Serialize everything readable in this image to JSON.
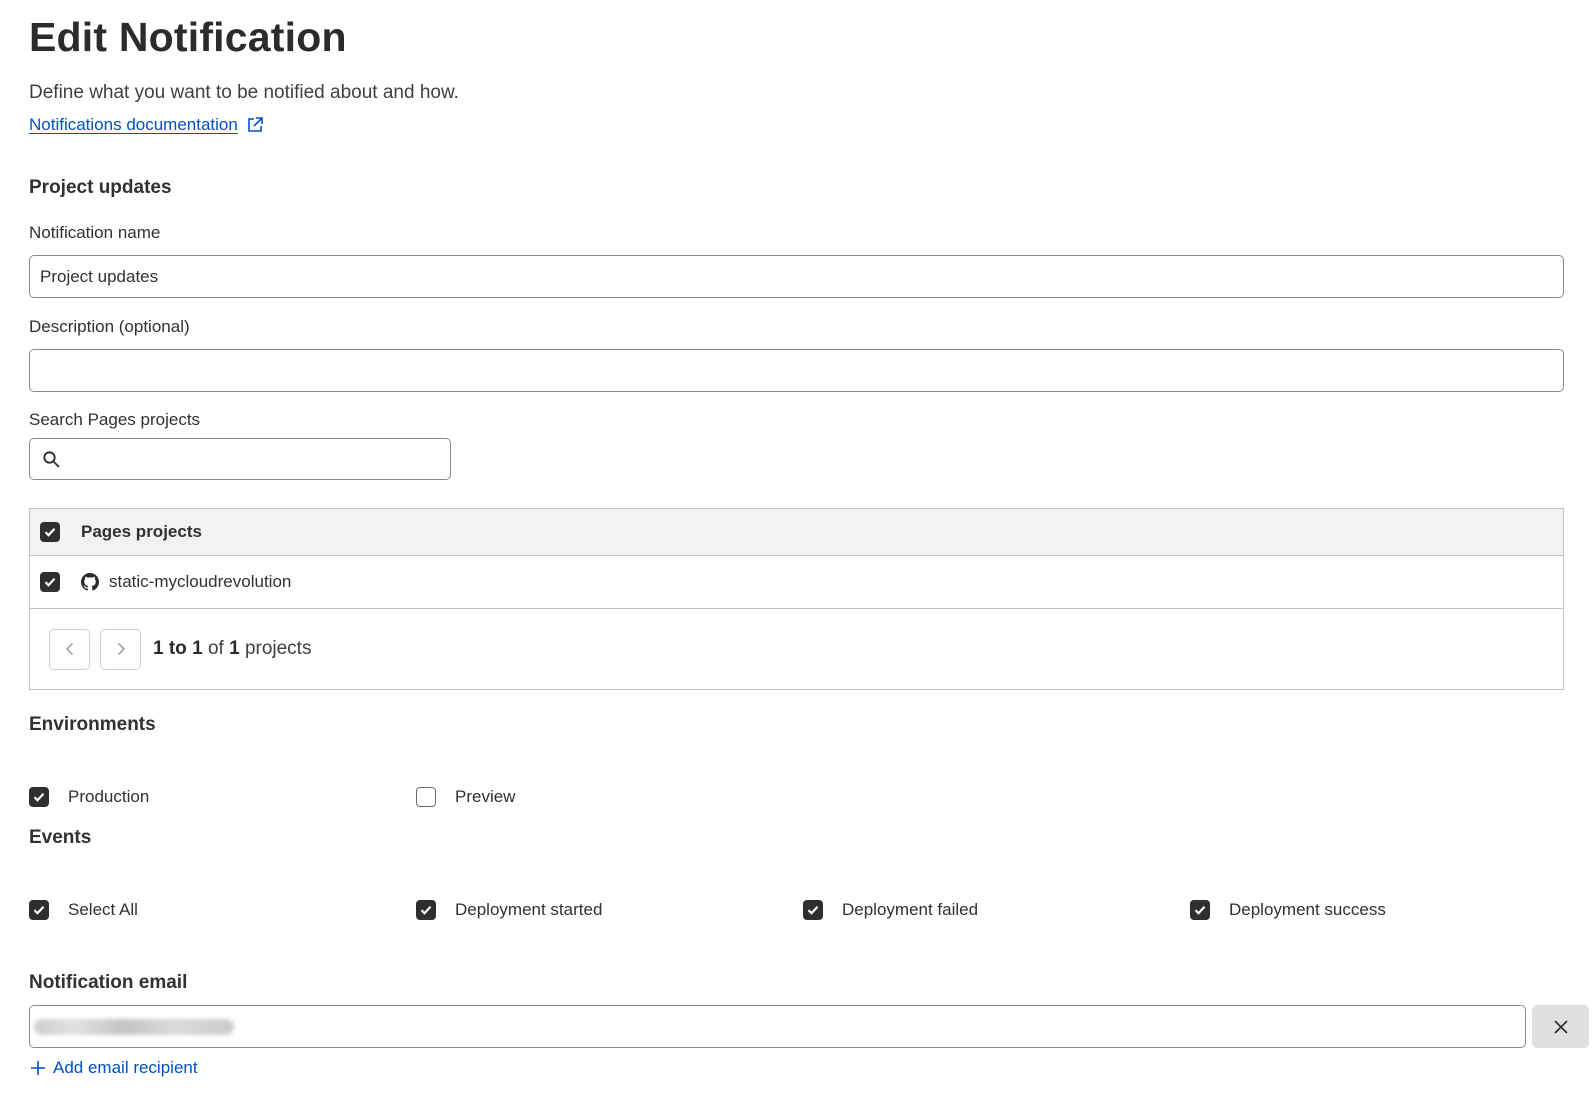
{
  "header": {
    "title": "Edit Notification",
    "subtitle": "Define what you want to be notified about and how.",
    "doc_link": "Notifications documentation"
  },
  "section": {
    "title": "Project updates"
  },
  "name_field": {
    "label": "Notification name",
    "value": "Project updates"
  },
  "description_field": {
    "label": "Description (optional)",
    "value": "",
    "placeholder": ""
  },
  "search": {
    "label": "Search Pages projects",
    "value": "",
    "placeholder": ""
  },
  "projects_table": {
    "header": "Pages projects",
    "header_checked": true,
    "rows": [
      {
        "name": "static-mycloudrevolution",
        "checked": true,
        "icon": "github-icon"
      }
    ]
  },
  "pagination": {
    "from": "1",
    "to_word": "to",
    "to": "1",
    "of_word": "of",
    "total": "1",
    "unit": "projects"
  },
  "environments": {
    "title": "Environments",
    "options": [
      {
        "label": "Production",
        "checked": true
      },
      {
        "label": "Preview",
        "checked": false
      }
    ]
  },
  "events": {
    "title": "Events",
    "options": [
      {
        "label": "Select All",
        "checked": true
      },
      {
        "label": "Deployment started",
        "checked": true
      },
      {
        "label": "Deployment failed",
        "checked": true
      },
      {
        "label": "Deployment success",
        "checked": true
      }
    ]
  },
  "email": {
    "title": "Notification email",
    "add_label": "Add email recipient"
  },
  "colors": {
    "link": "#0051c3",
    "checkbox": "#2f2f2f",
    "text": "#313131",
    "table_header_bg": "#f2f2f2"
  }
}
